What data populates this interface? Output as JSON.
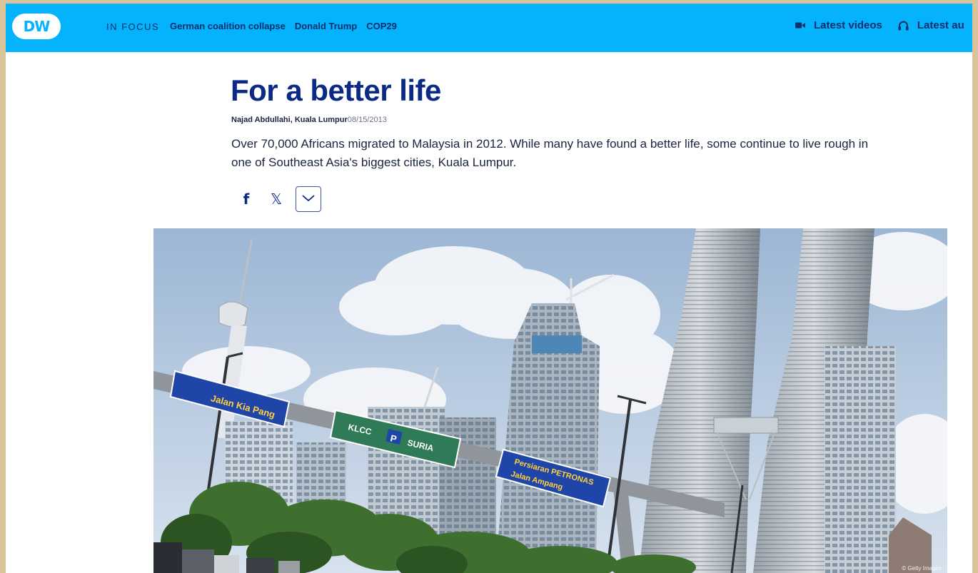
{
  "nav": {
    "logo": "DW",
    "in_focus_label": "IN FOCUS",
    "focus_links": [
      "German coalition collapse",
      "Donald Trump",
      "COP29"
    ],
    "latest_videos": "Latest videos",
    "latest_audio": "Latest au"
  },
  "article": {
    "title": "For a better life",
    "author": "Najad Abdullahi, Kuala Lumpur",
    "date": "08/15/2013",
    "lead": "Over 70,000 Africans migrated to Malaysia in 2012. While many have found a better life, some continue to live rough in one of Southeast Asia's biggest cities, Kuala Lumpur."
  },
  "share": {
    "facebook_glyph": "f",
    "x_glyph": "𝕏",
    "more_icon": "chevron-down-icon"
  },
  "hero": {
    "signs": {
      "left": "Jalan Kia Pang",
      "center_1": "KLCC",
      "center_p": "P",
      "center_2": "SURIA",
      "right_1": "Persiaran PETRONAS",
      "right_2": "Jalan Ampang"
    },
    "credit": "© Getty Images"
  },
  "colors": {
    "nav_bg": "#05b2fc",
    "title": "#0a2a86",
    "text": "#1a2340"
  }
}
